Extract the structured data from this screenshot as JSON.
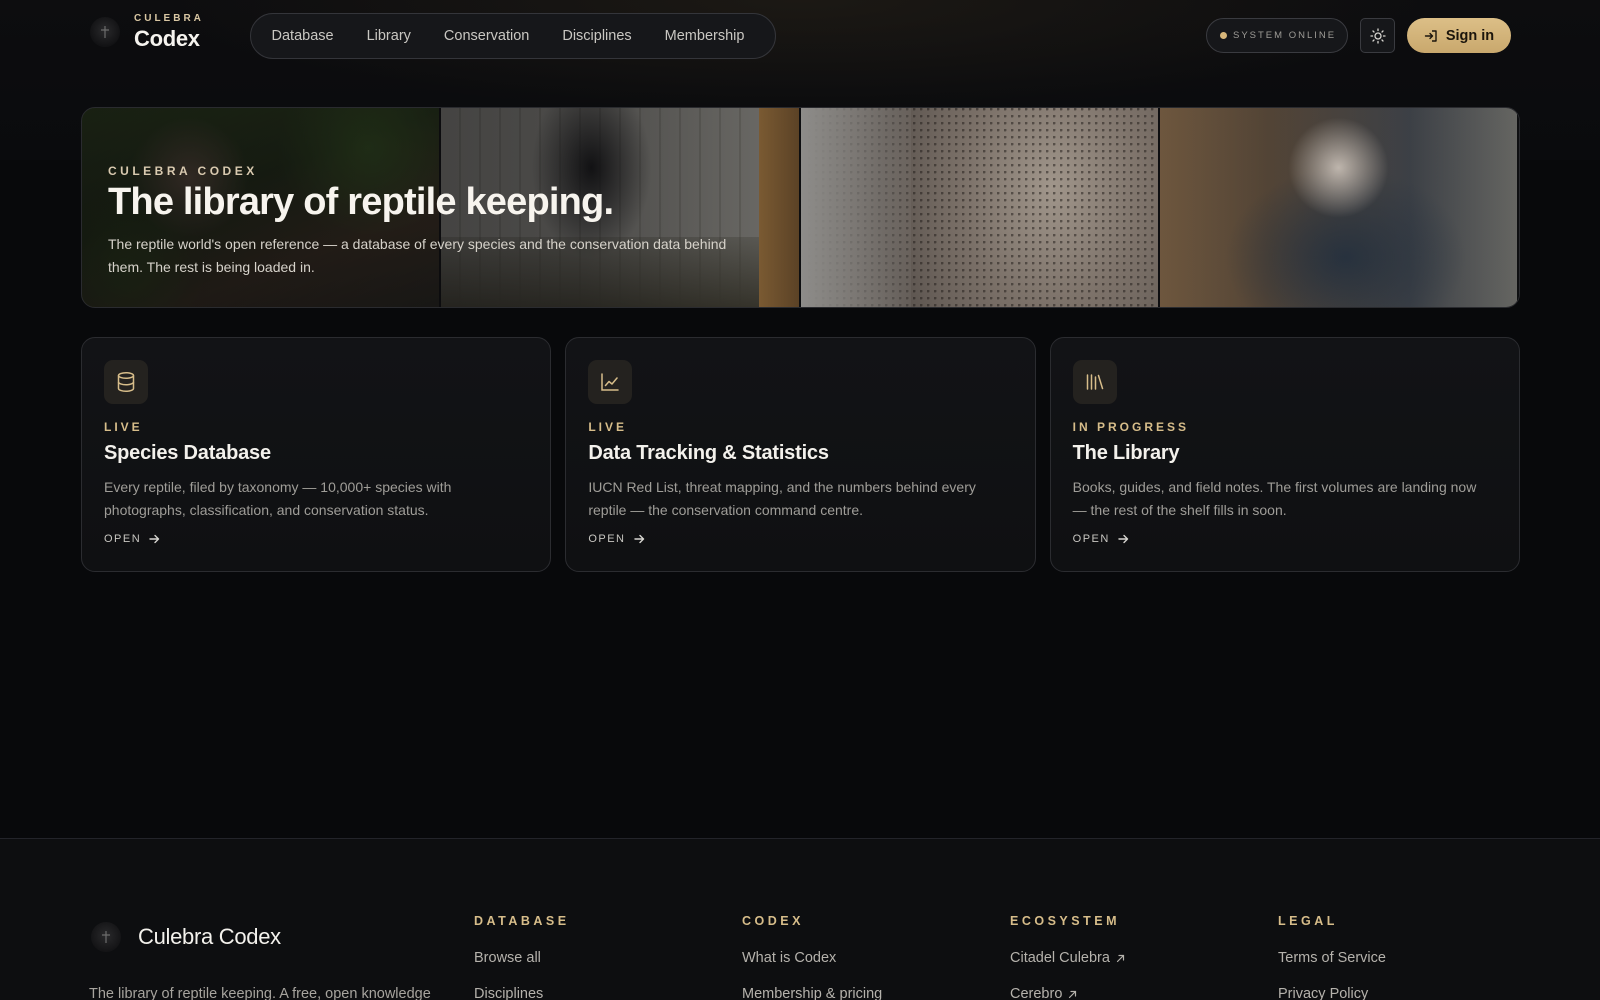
{
  "header": {
    "brand_kicker": "CULEBRA",
    "brand_name": "Codex",
    "nav": [
      "Database",
      "Library",
      "Conservation",
      "Disciplines",
      "Membership"
    ],
    "status": "SYSTEM ONLINE",
    "signin": "Sign in"
  },
  "hero": {
    "kicker": "CULEBRA CODEX",
    "title": "The library of reptile keeping.",
    "description_line1": "The reptile world's open reference — a database of every species and the conservation data behind",
    "description_line2": "them. The rest is being loaded in."
  },
  "cards": [
    {
      "icon": "database-icon",
      "status": "LIVE",
      "title": "Species Database",
      "desc_line1": "Every reptile, filed by taxonomy — 10,000+ species with",
      "desc_line2": "photographs, classification, and conservation status.",
      "open": "OPEN"
    },
    {
      "icon": "chart-icon",
      "status": "LIVE",
      "title": "Data Tracking & Statistics",
      "desc_line1": "IUCN Red List, threat mapping, and the numbers behind every",
      "desc_line2": "reptile — the conservation command centre.",
      "open": "OPEN"
    },
    {
      "icon": "library-icon",
      "status": "IN PROGRESS",
      "title": "The Library",
      "desc_line1": "Books, guides, and field notes. The first volumes are landing now",
      "desc_line2": "— the rest of the shelf fills in soon.",
      "open": "OPEN"
    }
  ],
  "footer": {
    "brand_name": "Culebra Codex",
    "tagline": "The library of reptile keeping. A free, open knowledge",
    "columns": [
      {
        "heading": "DATABASE",
        "links": [
          "Browse all",
          "Disciplines"
        ]
      },
      {
        "heading": "CODEX",
        "links": [
          "What is Codex",
          "Membership & pricing"
        ]
      },
      {
        "heading": "ECOSYSTEM",
        "links": [
          "Citadel Culebra",
          "Cerebro"
        ]
      },
      {
        "heading": "LEGAL",
        "links": [
          "Terms of Service",
          "Privacy Policy"
        ]
      }
    ]
  },
  "colors": {
    "background": "#08090b",
    "accent_gold": "#d7bd8a",
    "signin_gold": "#d2b37a"
  }
}
